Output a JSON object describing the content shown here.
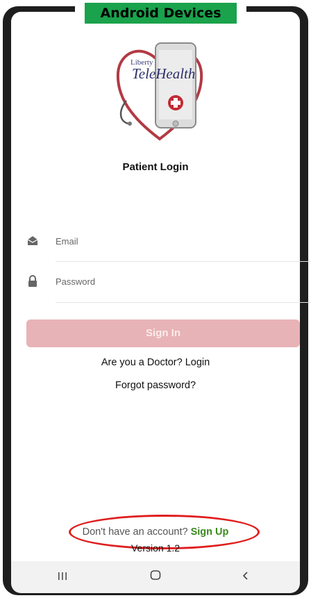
{
  "device_label": "Android Devices",
  "logo": {
    "small_text": "Liberty",
    "big_text": "TeleHealth"
  },
  "page_title": "Patient Login",
  "email_field": {
    "placeholder": "Email",
    "icon": "envelope-icon"
  },
  "password_field": {
    "placeholder": "Password",
    "icon": "lock-icon"
  },
  "signin_label": "Sign In",
  "doctor_login_label": "Are you a Doctor? Login",
  "forgot_password_label": "Forgot password?",
  "signup_prompt": "Don't have an account?",
  "signup_label": "Sign Up",
  "version_label": "Version 1.2",
  "nav": {
    "recents_icon": "recents-icon",
    "home_icon": "home-icon",
    "back_icon": "back-icon"
  },
  "colors": {
    "badge_green": "#1aa24c",
    "signin_bg": "#e8b3b6",
    "signup_green": "#3a8a1e",
    "highlight_red": "#e01e1e"
  }
}
